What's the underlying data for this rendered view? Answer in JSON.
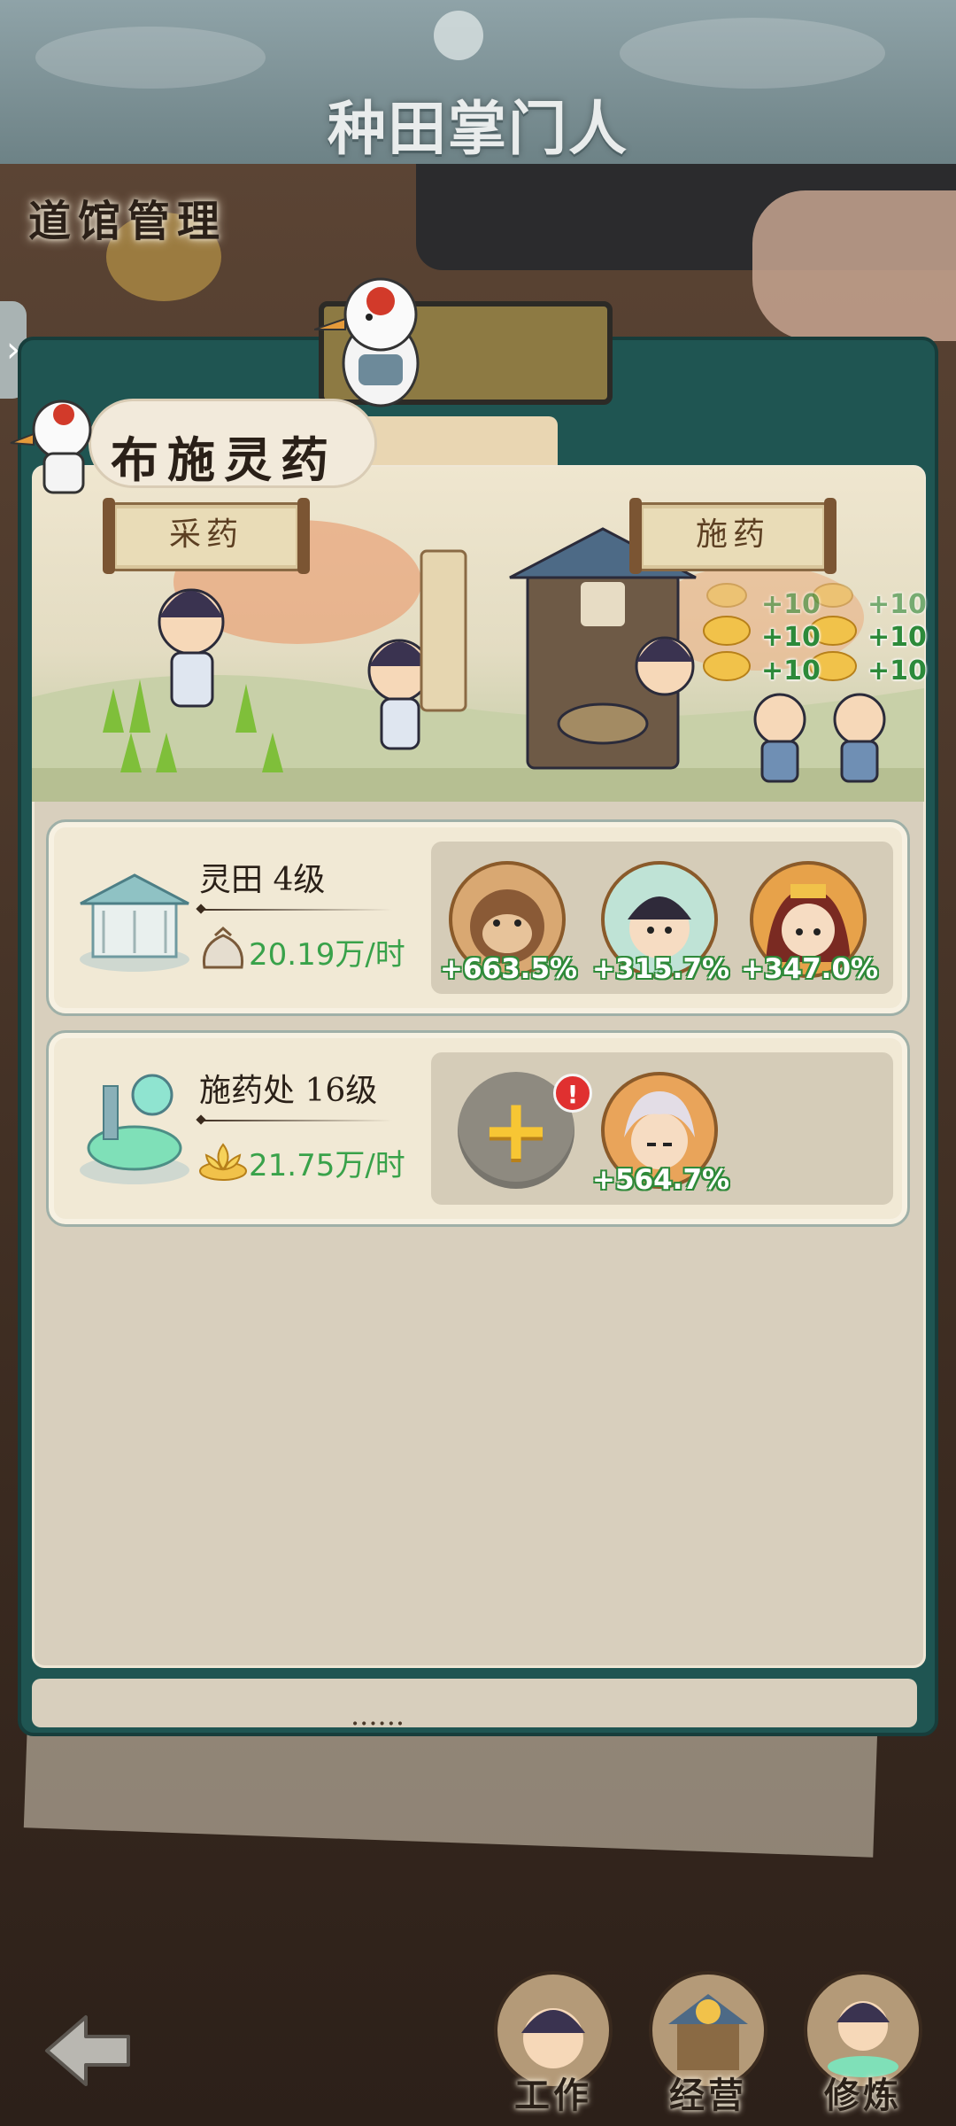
{
  "header": {
    "game_title": "种田掌门人"
  },
  "page": {
    "title": "道馆管理"
  },
  "section": {
    "title": "布施灵药",
    "buttons": {
      "gather": "采药",
      "distribute": "施药"
    },
    "rewards": [
      "+10",
      "+10",
      "+10",
      "+10",
      "+10",
      "+10"
    ]
  },
  "buildings": [
    {
      "name": "灵田 4级",
      "resource_icon": "herb-bundle-icon",
      "rate": "20.19万/时",
      "disciples": [
        {
          "portrait": "monkey-disciple-avatar",
          "bonus": "+663.5%"
        },
        {
          "portrait": "scholar-disciple-avatar",
          "bonus": "+315.7%"
        },
        {
          "portrait": "crowned-disciple-avatar",
          "bonus": "+347.0%"
        }
      ]
    },
    {
      "name": "施药处 16级",
      "resource_icon": "golden-lotus-icon",
      "rate": "21.75万/时",
      "add_slot_alert": "!",
      "disciples": [
        {
          "portrait": "silver-hair-disciple-avatar",
          "bonus": "+564.7%"
        }
      ]
    }
  ],
  "bottom_nav": {
    "back_icon": "back-arrow-icon",
    "items": [
      {
        "label": "工作"
      },
      {
        "label": "经营"
      },
      {
        "label": "修炼"
      }
    ]
  },
  "colors": {
    "accent_green": "#39a24a",
    "panel_teal": "#1f5552",
    "card_bg": "#d8cfbd"
  }
}
